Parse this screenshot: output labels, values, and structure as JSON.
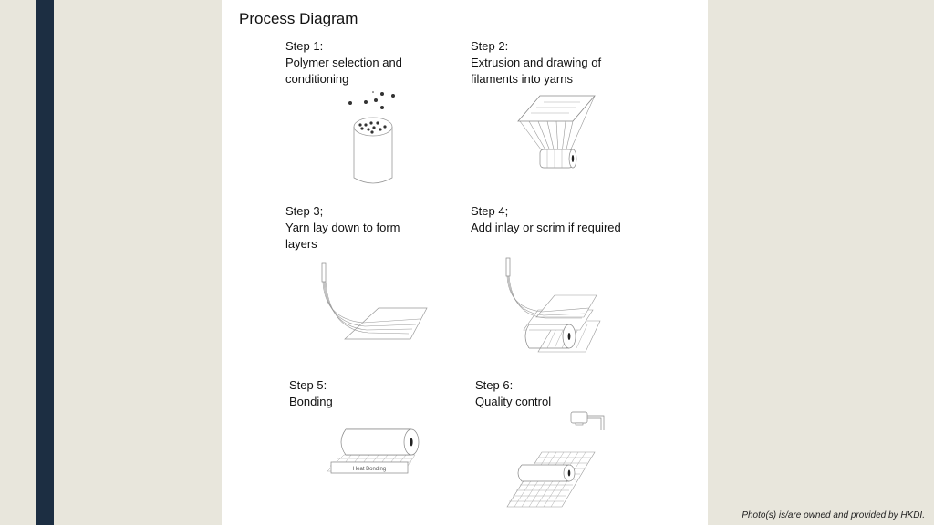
{
  "slide": {
    "title": "Process Diagram",
    "caption": "Photo(s) is/are owned and provided by HKDI.",
    "colors": {
      "sidebar": "#1c2e42",
      "background": "#e8e6dc",
      "panel": "#ffffff"
    }
  },
  "steps": [
    {
      "heading": "Step 1:",
      "line1": "Polymer selection and",
      "line2": "conditioning",
      "illustration": "polymer-pellets-container"
    },
    {
      "heading": "Step 2:",
      "line1": "Extrusion and drawing of",
      "line2": "filaments into yarns",
      "illustration": "filament-extrusion-spools"
    },
    {
      "heading": "Step 3;",
      "line1": "Yarn lay down to form",
      "line2": "layers",
      "illustration": "yarn-laydown"
    },
    {
      "heading": "Step 4;",
      "line1": "Add inlay or scrim if required",
      "line2": "",
      "illustration": "inlay-scrim-roller"
    },
    {
      "heading": "Step 5:",
      "line1": "Bonding",
      "line2": "",
      "illustration": "heat-bonding-roller",
      "label": "Heat Bonding"
    },
    {
      "heading": "Step 6:",
      "line1": "Quality control",
      "line2": "",
      "illustration": "quality-control-camera"
    }
  ]
}
